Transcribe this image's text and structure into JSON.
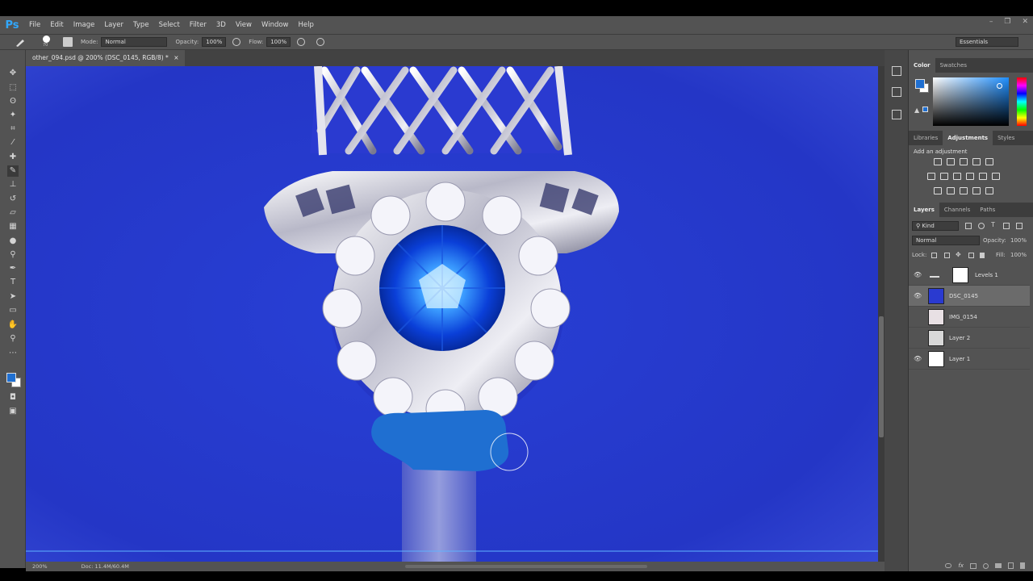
{
  "app": {
    "logo": "Ps"
  },
  "menu": [
    "File",
    "Edit",
    "Image",
    "Layer",
    "Type",
    "Select",
    "Filter",
    "3D",
    "View",
    "Window",
    "Help"
  ],
  "window_controls": [
    "–",
    "❐",
    "✕"
  ],
  "options": {
    "brush_size": "70",
    "mode_label": "Mode:",
    "mode_value": "Normal",
    "opacity_label": "Opacity:",
    "opacity_value": "100%",
    "flow_label": "Flow:",
    "flow_value": "100%",
    "workspace": "Essentials"
  },
  "document": {
    "tab_title": "other_094.psd @ 200% (DSC_0145, RGB/8) *",
    "close": "×",
    "zoom": "200%",
    "doc_info": "Doc: 11.4M/60.4M"
  },
  "color_panel": {
    "tabs": [
      "Color",
      "Swatches"
    ],
    "foreground": "#1f6fd1",
    "background": "#ffffff"
  },
  "adjustments_panel": {
    "tabs": [
      "Libraries",
      "Adjustments",
      "Styles"
    ],
    "active_tab": "Adjustments",
    "heading": "Add an adjustment"
  },
  "layers_panel": {
    "tabs": [
      "Layers",
      "Channels",
      "Paths"
    ],
    "kind_label": "Kind",
    "blend_mode": "Normal",
    "opacity_label": "Opacity:",
    "opacity_value": "100%",
    "lock_label": "Lock:",
    "fill_label": "Fill:",
    "fill_value": "100%",
    "layers": [
      {
        "name": "Levels 1",
        "visible": true,
        "selected": false
      },
      {
        "name": "DSC_0145",
        "visible": true,
        "selected": true
      },
      {
        "name": "IMG_0154",
        "visible": false,
        "selected": false
      },
      {
        "name": "Layer 2",
        "visible": false,
        "selected": false
      },
      {
        "name": "Layer 1",
        "visible": true,
        "selected": false
      }
    ]
  }
}
